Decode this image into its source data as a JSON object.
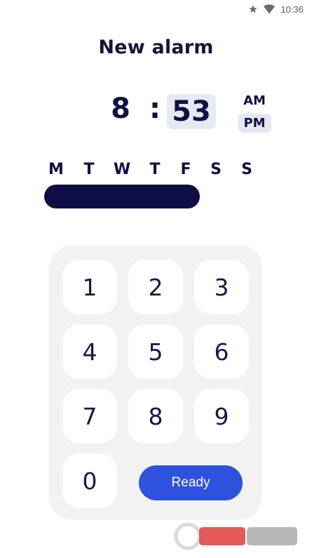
{
  "status_bar": {
    "time": "10:36",
    "icons": [
      "star-icon",
      "wifi-icon"
    ]
  },
  "header": {
    "title": "New alarm"
  },
  "time": {
    "hour": "8",
    "separator": ":",
    "minute": "53",
    "am_label": "AM",
    "pm_label": "PM",
    "selected_period": "PM"
  },
  "days": {
    "labels": [
      "M",
      "T",
      "W",
      "T",
      "F",
      "S",
      "S"
    ],
    "selected_range": "M-F"
  },
  "keypad": {
    "keys": [
      "1",
      "2",
      "3",
      "4",
      "5",
      "6",
      "7",
      "8",
      "9",
      "0"
    ],
    "ready_label": "Ready"
  },
  "colors": {
    "primary_dark": "#101043",
    "accent_blue": "#2f52de",
    "selected_bg": "#e6e9f2",
    "keypad_bg": "#f2f2f3"
  }
}
